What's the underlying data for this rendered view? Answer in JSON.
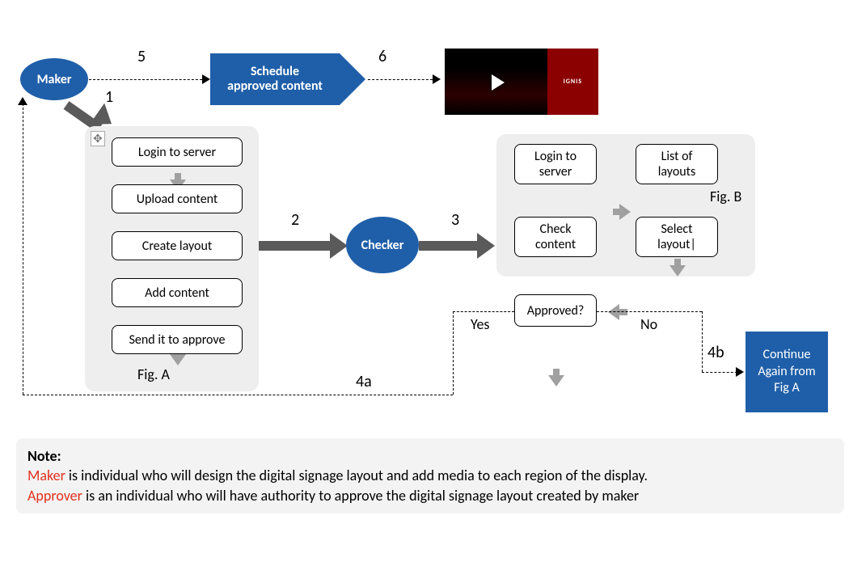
{
  "diagram": {
    "actors": {
      "maker": "Maker",
      "checker": "Checker"
    },
    "schedule_box": "Schedule\napproved content",
    "steps": {
      "s1": "1",
      "s2": "2",
      "s3": "3",
      "s4a": "4a",
      "s4b": "4b",
      "s5": "5",
      "s6": "6"
    },
    "figA": {
      "label": "Fig. A",
      "boxes": [
        "Login to server",
        "Upload content",
        "Create layout",
        "Add content",
        "Send it to approve"
      ]
    },
    "figB": {
      "label": "Fig. B",
      "boxes": {
        "login": "Login to\nserver",
        "list": "List of\nlayouts",
        "select": "Select\nlayout|",
        "check": "Check\ncontent"
      }
    },
    "decision": {
      "label": "Approved?",
      "yes": "Yes",
      "no": "No"
    },
    "continue_box": "Continue\nAgain from\nFig A",
    "note": {
      "title": "Note:",
      "maker_term": "Maker",
      "maker_rest": " is individual who will design the digital signage layout and add media to each region of the display.",
      "approver_term": "Approver",
      "approver_rest": " is an individual who will have authority to approve the digital signage layout created by maker"
    },
    "thumb": {
      "brand": "IGNIS"
    }
  }
}
